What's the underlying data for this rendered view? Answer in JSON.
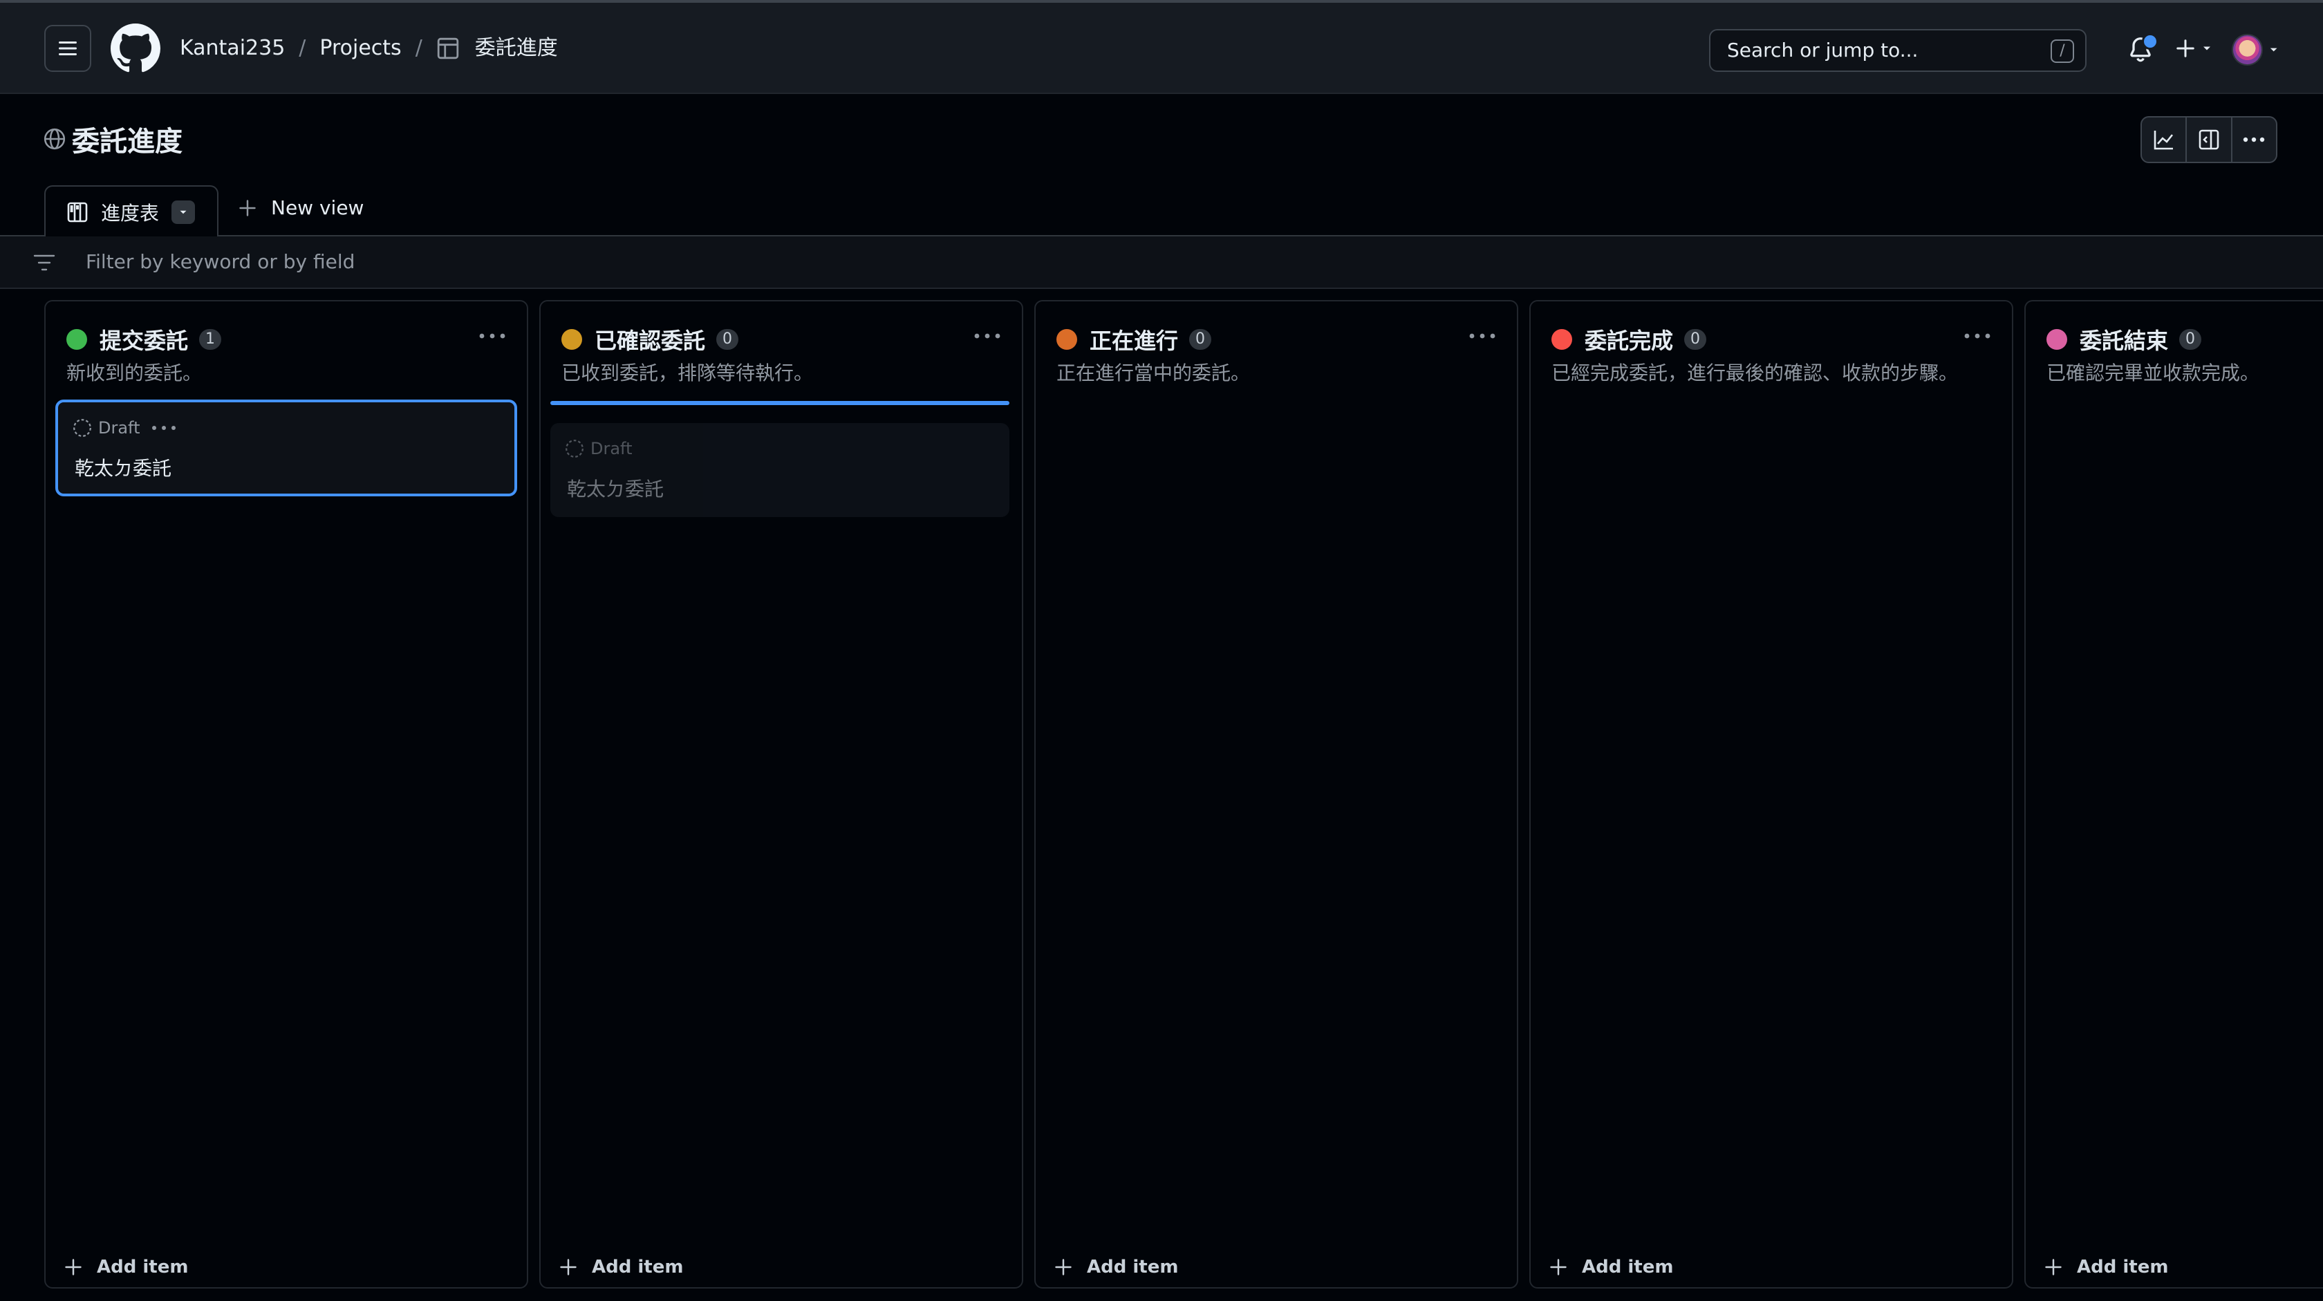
{
  "header": {
    "breadcrumbs": [
      "Kantai235",
      "Projects",
      "委託進度"
    ],
    "breadcrumb_sep": "/",
    "search_placeholder": "Search or jump to...",
    "search_shortcut": "/"
  },
  "project": {
    "title": "委託進度"
  },
  "tabs": {
    "active_view": "進度表",
    "new_view_label": "New view"
  },
  "filter": {
    "placeholder": "Filter by keyword or by field"
  },
  "columns": [
    {
      "name": "提交委託",
      "count": "1",
      "description": "新收到的委託。",
      "color": "#3fb950",
      "add_label": "Add item"
    },
    {
      "name": "已確認委託",
      "count": "0",
      "description": "已收到委託，排隊等待執行。",
      "color": "#d29922",
      "add_label": "Add item"
    },
    {
      "name": "正在進行",
      "count": "0",
      "description": "正在進行當中的委託。",
      "color": "#db6d28",
      "add_label": "Add item"
    },
    {
      "name": "委託完成",
      "count": "0",
      "description": "已經完成委託，進行最後的確認、收款的步驟。",
      "color": "#f85149",
      "add_label": "Add item"
    },
    {
      "name": "委託結束",
      "count": "0",
      "description": "已確認完畢並收款完成。",
      "color": "#db61a2",
      "add_label": "Add item"
    }
  ],
  "cards": {
    "active": {
      "status": "Draft",
      "title": "乾太ㄉ委託"
    },
    "ghost": {
      "status": "Draft",
      "title": "乾太ㄉ委託"
    }
  }
}
